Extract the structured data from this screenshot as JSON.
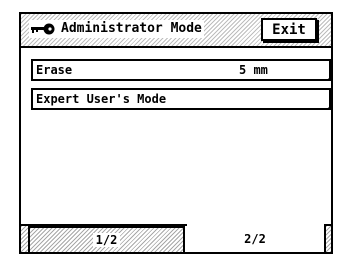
{
  "header": {
    "title": "Administrator Mode",
    "icon": "key-icon",
    "exit_label": "Exit"
  },
  "menu": {
    "items": [
      {
        "label": "Erase",
        "value": "5 mm"
      },
      {
        "label": "Expert User's Mode",
        "value": ""
      }
    ]
  },
  "tabs": [
    {
      "label": "1/2",
      "selected": false
    },
    {
      "label": "2/2",
      "selected": true
    }
  ]
}
